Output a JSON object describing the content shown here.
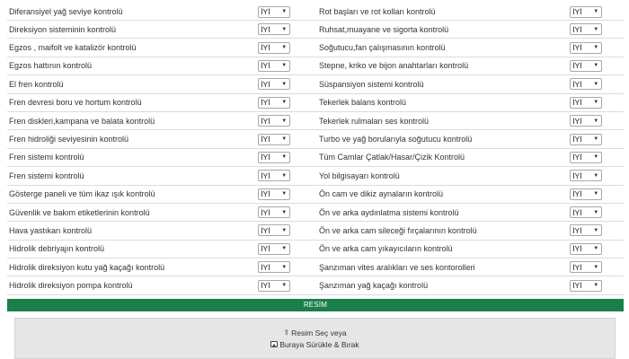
{
  "rows": [
    {
      "left": {
        "label": "Diferansiyel yağ seviye kontrolü",
        "value": "İYİ"
      },
      "right": {
        "label": "Rot başları ve rot kolları kontrolü",
        "value": "İYİ"
      }
    },
    {
      "left": {
        "label": "Direksiyon sisteminin kontrolü",
        "value": "İYİ"
      },
      "right": {
        "label": "Ruhsat,muayane ve sigorta kontrolü",
        "value": "İYİ"
      }
    },
    {
      "left": {
        "label": "Egzos , maifolt ve katalizör kontrolü",
        "value": "İYİ"
      },
      "right": {
        "label": "Soğutucu,fan çalışmasının kontrolü",
        "value": "İYİ"
      }
    },
    {
      "left": {
        "label": "Egzos hattının kontrolü",
        "value": "İYİ"
      },
      "right": {
        "label": "Stepne, kriko ve bijon anahtarları kontrolü",
        "value": "İYİ"
      }
    },
    {
      "left": {
        "label": "El fren kontrolü",
        "value": "İYİ"
      },
      "right": {
        "label": "Süspansiyon sistemi kontrolü",
        "value": "İYİ"
      }
    },
    {
      "left": {
        "label": "Fren devresi boru ve hortum kontrolü",
        "value": "İYİ"
      },
      "right": {
        "label": "Tekerlek balans kontrolü",
        "value": "İYİ"
      }
    },
    {
      "left": {
        "label": "Fren diskleri,kampana ve balata kontrolü",
        "value": "İYİ"
      },
      "right": {
        "label": "Tekerlek rulmaları ses kontrolü",
        "value": "İYİ"
      }
    },
    {
      "left": {
        "label": "Fren hidroliği seviyesinin kontrolü",
        "value": "İYİ"
      },
      "right": {
        "label": "Turbo ve yağ borularıyla soğutucu kontrolü",
        "value": "İYİ"
      }
    },
    {
      "left": {
        "label": "Fren sistemi kontrolü",
        "value": "İYİ"
      },
      "right": {
        "label": "Tüm Camlar Çatlak/Hasar/Çizik Kontrolü",
        "value": "İYİ"
      }
    },
    {
      "left": {
        "label": "Fren sistemi kontrolü",
        "value": "İYİ"
      },
      "right": {
        "label": "Yol bilgisayarı kontrolü",
        "value": "İYİ"
      }
    },
    {
      "left": {
        "label": "Gösterge paneli ve tüm ikaz ışık kontrolü",
        "value": "İYİ"
      },
      "right": {
        "label": "Ön cam ve dikiz aynaların kontrolü",
        "value": "İYİ"
      }
    },
    {
      "left": {
        "label": "Güvenlik ve bakım etiketlerinin kontrolü",
        "value": "İYİ"
      },
      "right": {
        "label": "Ön ve arka aydınlatma sistemi kontrolü",
        "value": "İYİ"
      }
    },
    {
      "left": {
        "label": "Hava yastıkarı kontrolü",
        "value": "İYİ"
      },
      "right": {
        "label": "Ön ve arka cam sileceği fırçalarının kontrolü",
        "value": "İYİ"
      }
    },
    {
      "left": {
        "label": "Hidrolik debriyajın kontrolü",
        "value": "İYİ"
      },
      "right": {
        "label": "Ön ve arka cam yıkayıcıların kontrolü",
        "value": "İYİ"
      }
    },
    {
      "left": {
        "label": "Hidrolik direksiyon kutu yağ kaçağı kontrolü",
        "value": "İYİ"
      },
      "right": {
        "label": "Şanzıman vites aralıkları ve ses kontorolleri",
        "value": "İYİ"
      }
    },
    {
      "left": {
        "label": "Hidrolik direksiyon pompa kontrolü",
        "value": "İYİ"
      },
      "right": {
        "label": "Şanzıman yağ kaçağı kontrolü",
        "value": "İYİ"
      }
    }
  ],
  "resim_bar": {
    "label": "RESİM",
    "color": "#1a7f4b"
  },
  "upload": {
    "line1": "Resim Seç veya",
    "line2": "Buraya Sürükle & Bırak",
    "icon1": "upload-icon",
    "icon2": "image-icon"
  }
}
